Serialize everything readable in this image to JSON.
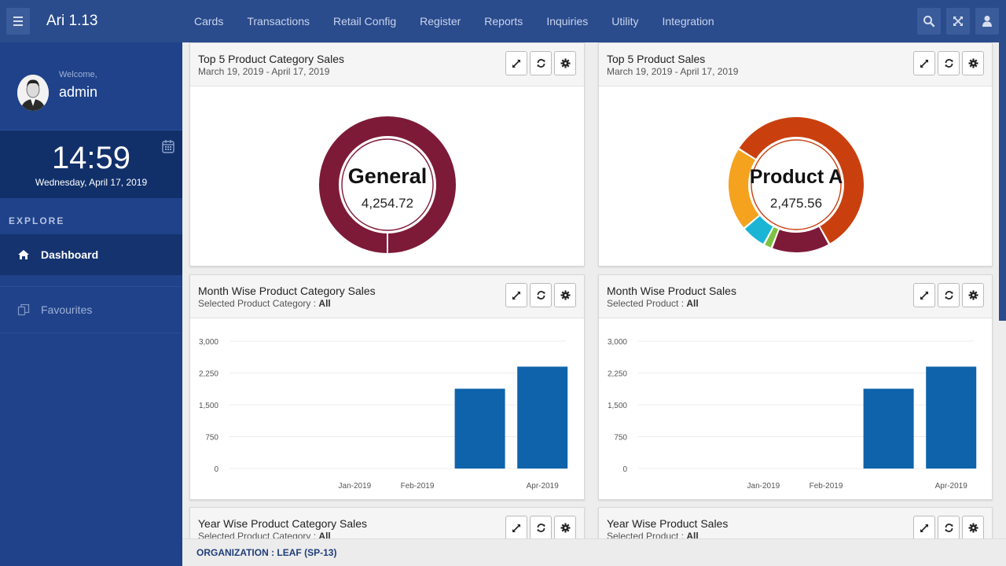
{
  "app": {
    "title": "Ari 1.13"
  },
  "nav": {
    "items": [
      "Cards",
      "Transactions",
      "Retail Config",
      "Register",
      "Reports",
      "Inquiries",
      "Utility",
      "Integration"
    ]
  },
  "user": {
    "welcome": "Welcome,",
    "name": "admin"
  },
  "clock": {
    "time": "14:59",
    "date": "Wednesday, April 17, 2019"
  },
  "sidebar": {
    "section": "EXPLORE",
    "items": [
      {
        "label": "Dashboard",
        "icon": "home-icon"
      },
      {
        "label": "Favourites",
        "icon": "copy-icon"
      }
    ]
  },
  "panels": {
    "p1": {
      "title": "Top 5 Product Category Sales",
      "subtitle": "March 19, 2019 - April 17, 2019"
    },
    "p2": {
      "title": "Top 5 Product Sales",
      "subtitle": "March 19, 2019 - April 17, 2019"
    },
    "p3": {
      "title": "Month Wise Product Category Sales",
      "sub_label": "Selected Product Category : ",
      "sub_value": "All"
    },
    "p4": {
      "title": "Month Wise Product Sales",
      "sub_label": "Selected Product : ",
      "sub_value": "All"
    },
    "p5": {
      "title": "Year Wise Product Category Sales",
      "sub_label": "Selected Product Category : ",
      "sub_value": "All"
    },
    "p6": {
      "title": "Year Wise Product Sales",
      "sub_label": "Selected Product : ",
      "sub_value": "All"
    }
  },
  "footer": {
    "org": "ORGANIZATION : LEAF (SP-13)"
  },
  "colors": {
    "topbar": "#2a4b8c",
    "sidebar": "#1f428a",
    "bar": "#0e63ab",
    "donut_general": "#7d1a38"
  },
  "chart_data": [
    {
      "type": "pie",
      "donut": true,
      "center_label": "General",
      "center_value": "4,254.72",
      "slices": [
        {
          "value": 100,
          "color": "#7d1a38"
        }
      ]
    },
    {
      "type": "pie",
      "donut": true,
      "center_label": "Product A",
      "center_value": "2,475.56",
      "slices": [
        {
          "value": 58,
          "color": "#c9400e"
        },
        {
          "value": 14,
          "color": "#7d1a38"
        },
        {
          "value": 2,
          "color": "#7dc242"
        },
        {
          "value": 6,
          "color": "#1ab5d4"
        },
        {
          "value": 20,
          "color": "#f5a21f"
        }
      ]
    },
    {
      "type": "bar",
      "categories": [
        "",
        "Jan-2019",
        "Feb-2019",
        "",
        "Apr-2019"
      ],
      "values": [
        0,
        0,
        0,
        1880,
        2400
      ],
      "yticks": [
        "0",
        "750",
        "1,500",
        "2,250",
        "3,000"
      ],
      "ylim": [
        0,
        3000
      ]
    },
    {
      "type": "bar",
      "categories": [
        "",
        "Jan-2019",
        "Feb-2019",
        "",
        "Apr-2019"
      ],
      "values": [
        0,
        0,
        0,
        1880,
        2400
      ],
      "yticks": [
        "0",
        "750",
        "1,500",
        "2,250",
        "3,000"
      ],
      "ylim": [
        0,
        3000
      ]
    }
  ]
}
